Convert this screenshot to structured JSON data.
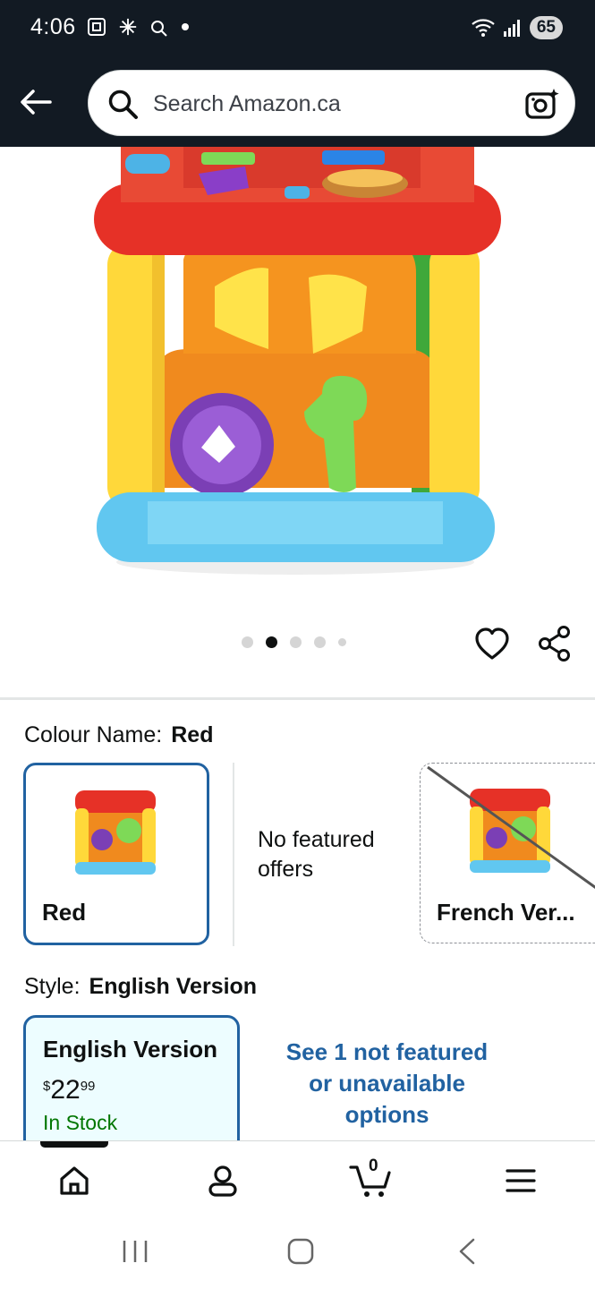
{
  "status_bar": {
    "time": "4:06",
    "battery": "65"
  },
  "header": {
    "search_placeholder": "Search Amazon.ca"
  },
  "product": {
    "image_alt": "Baby activity cube toy",
    "carousel_total": 5,
    "carousel_active": 2
  },
  "colour": {
    "label": "Colour Name:",
    "value": "Red",
    "options": [
      {
        "name": "Red",
        "selected": true,
        "available": true
      },
      {
        "name": "French Ver...",
        "selected": false,
        "available": false
      }
    ],
    "no_offers_text": "No featured offers"
  },
  "style": {
    "label": "Style:",
    "value": "English Version",
    "card": {
      "name": "English Version",
      "currency": "$",
      "price_whole": "22",
      "price_fraction": "99",
      "stock": "In Stock"
    },
    "see_more": "See 1 not featured or unavailable options"
  },
  "bottom_nav": {
    "items": [
      "home-icon",
      "account-icon",
      "cart-icon",
      "menu-icon"
    ],
    "cart_count": "0"
  },
  "colors": {
    "header_bg": "#121a23",
    "link": "#2162a1",
    "in_stock": "#007600",
    "selected_bg": "#edfdff"
  }
}
